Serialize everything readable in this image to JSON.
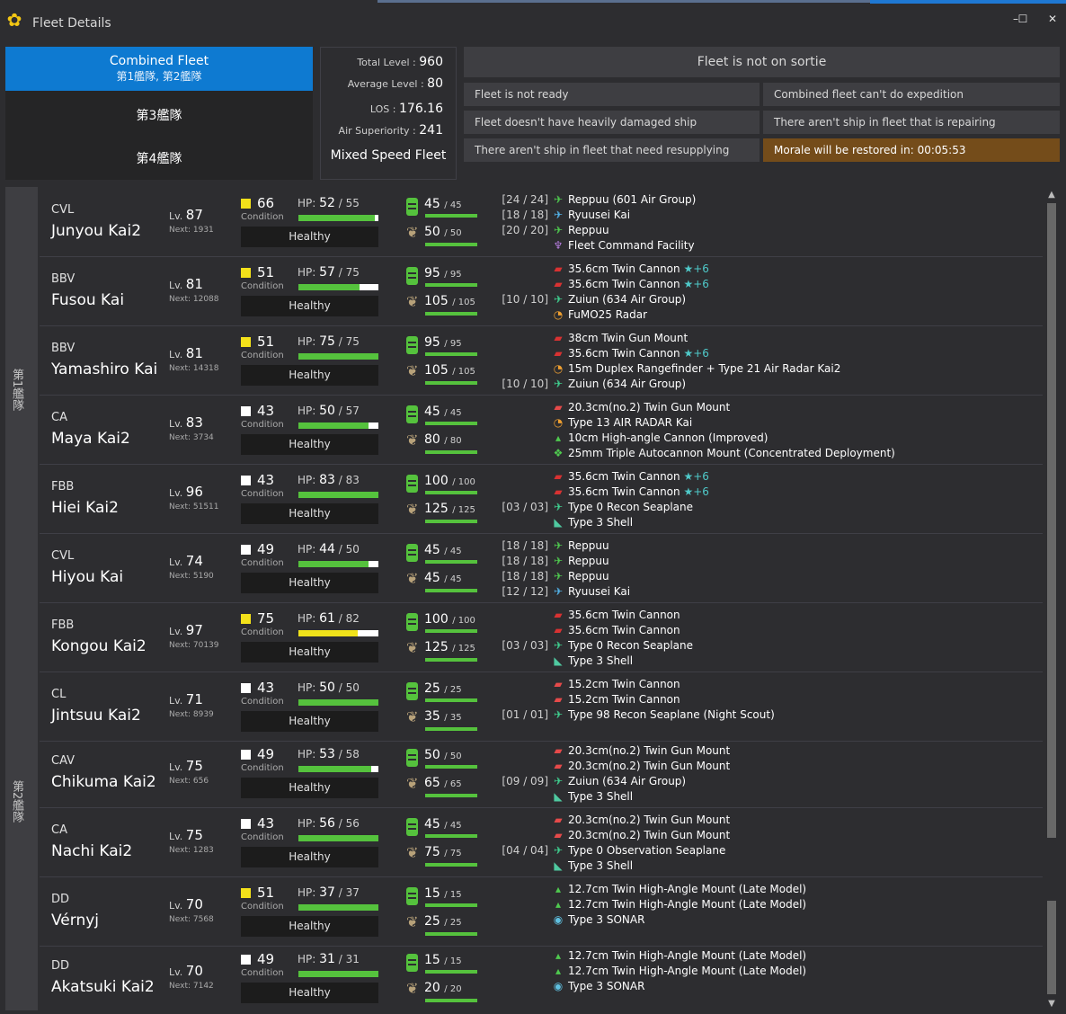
{
  "window": {
    "title": "Fleet Details",
    "min": "–",
    "max": "☐",
    "close": "✕"
  },
  "fleets": {
    "combined_title": "Combined Fleet",
    "combined_sub": "第1艦隊, 第2艦隊",
    "fleet3": "第3艦隊",
    "fleet4": "第4艦隊"
  },
  "stats": {
    "total_label": "Total Level :",
    "total": "960",
    "avg_label": "Average Level :",
    "avg": "80",
    "los_label": "LOS :",
    "los": "176.16",
    "air_label": "Air Superiority :",
    "air": "241",
    "speed": "Mixed Speed Fleet"
  },
  "status": {
    "sortie": "Fleet is not on sortie",
    "r1a": "Fleet is not ready",
    "r1b": "Combined fleet can't do expedition",
    "r2a": "Fleet doesn't have heavily damaged ship",
    "r2b": "There aren't ship in fleet that is repairing",
    "r3a": "There aren't ship in fleet that need resupplying",
    "r3b": "Morale will be restored in: 00:05:53"
  },
  "side": {
    "fleet1": "第1艦隊",
    "fleet2": "第2艦隊"
  },
  "labels": {
    "lv": "Lv.",
    "next": "Next:",
    "condition": "Condition",
    "hp": "HP:"
  },
  "colors": {
    "accent": "#0e7ad1",
    "bar_green": "#55c23d",
    "bar_yellow": "#f0e21a",
    "cond_yellow": "#f3e11a",
    "morale_bg": "#744c1a"
  },
  "ships": [
    {
      "type": "CVL",
      "name": "Junyou Kai2",
      "lv": "87",
      "next": "1931",
      "cond": "66",
      "cond_color": "yellow",
      "hp": "52",
      "maxhp": "55",
      "health": "Healthy",
      "fuel": "45",
      "maxfuel": "45",
      "ammo": "50",
      "maxammo": "50",
      "equip": [
        {
          "slot": "[24 / 24]",
          "icon": "fighter-icon",
          "name": "Reppuu (601 Air Group)"
        },
        {
          "slot": "[18 / 18]",
          "icon": "torpedo-bomber-icon",
          "name": "Ryuusei Kai"
        },
        {
          "slot": "[20 / 20]",
          "icon": "fighter-icon",
          "name": "Reppuu"
        },
        {
          "slot": "",
          "icon": "command-facility-icon",
          "name": "Fleet Command Facility"
        }
      ]
    },
    {
      "type": "BBV",
      "name": "Fusou Kai",
      "lv": "81",
      "next": "12088",
      "cond": "51",
      "cond_color": "yellow",
      "hp": "57",
      "maxhp": "75",
      "health": "Healthy",
      "fuel": "95",
      "maxfuel": "95",
      "ammo": "105",
      "maxammo": "105",
      "equip": [
        {
          "slot": "",
          "icon": "large-gun-icon",
          "name": "35.6cm Twin Cannon",
          "star": "★+6"
        },
        {
          "slot": "",
          "icon": "large-gun-icon",
          "name": "35.6cm Twin Cannon",
          "star": "★+6"
        },
        {
          "slot": "[10 / 10]",
          "icon": "seaplane-icon",
          "name": "Zuiun (634 Air Group)"
        },
        {
          "slot": "",
          "icon": "radar-icon",
          "name": "FuMO25 Radar"
        }
      ]
    },
    {
      "type": "BBV",
      "name": "Yamashiro Kai",
      "lv": "81",
      "next": "14318",
      "cond": "51",
      "cond_color": "yellow",
      "hp": "75",
      "maxhp": "75",
      "health": "Healthy",
      "fuel": "95",
      "maxfuel": "95",
      "ammo": "105",
      "maxammo": "105",
      "equip": [
        {
          "slot": "",
          "icon": "large-gun-icon",
          "name": "38cm Twin Gun Mount"
        },
        {
          "slot": "",
          "icon": "large-gun-icon",
          "name": "35.6cm Twin Cannon",
          "star": "★+6"
        },
        {
          "slot": "",
          "icon": "radar-icon",
          "name": "15m Duplex Rangefinder + Type 21 Air Radar Kai2"
        },
        {
          "slot": "[10 / 10]",
          "icon": "seaplane-icon",
          "name": "Zuiun (634 Air Group)"
        }
      ]
    },
    {
      "type": "CA",
      "name": "Maya Kai2",
      "lv": "83",
      "next": "3734",
      "cond": "43",
      "cond_color": "white",
      "hp": "50",
      "maxhp": "57",
      "health": "Healthy",
      "fuel": "45",
      "maxfuel": "45",
      "ammo": "80",
      "maxammo": "80",
      "equip": [
        {
          "slot": "",
          "icon": "medium-gun-icon",
          "name": "20.3cm(no.2) Twin Gun Mount"
        },
        {
          "slot": "",
          "icon": "radar-icon",
          "name": "Type 13 AIR RADAR Kai"
        },
        {
          "slot": "",
          "icon": "high-angle-gun-icon",
          "name": "10cm High-angle Cannon (Improved)"
        },
        {
          "slot": "",
          "icon": "aa-gun-icon",
          "name": "25mm Triple Autocannon Mount (Concentrated Deployment)"
        }
      ]
    },
    {
      "type": "FBB",
      "name": "Hiei Kai2",
      "lv": "96",
      "next": "51511",
      "cond": "43",
      "cond_color": "white",
      "hp": "83",
      "maxhp": "83",
      "health": "Healthy",
      "fuel": "100",
      "maxfuel": "100",
      "ammo": "125",
      "maxammo": "125",
      "equip": [
        {
          "slot": "",
          "icon": "large-gun-icon",
          "name": "35.6cm Twin Cannon",
          "star": "★+6"
        },
        {
          "slot": "",
          "icon": "large-gun-icon",
          "name": "35.6cm Twin Cannon",
          "star": "★+6"
        },
        {
          "slot": "[03 / 03]",
          "icon": "seaplane-icon",
          "name": "Type 0 Recon Seaplane"
        },
        {
          "slot": "",
          "icon": "shell-icon",
          "name": "Type 3 Shell"
        }
      ]
    },
    {
      "type": "CVL",
      "name": "Hiyou Kai",
      "lv": "74",
      "next": "5190",
      "cond": "49",
      "cond_color": "white",
      "hp": "44",
      "maxhp": "50",
      "health": "Healthy",
      "fuel": "45",
      "maxfuel": "45",
      "ammo": "45",
      "maxammo": "45",
      "equip": [
        {
          "slot": "[18 / 18]",
          "icon": "fighter-icon",
          "name": "Reppuu"
        },
        {
          "slot": "[18 / 18]",
          "icon": "fighter-icon",
          "name": "Reppuu"
        },
        {
          "slot": "[18 / 18]",
          "icon": "fighter-icon",
          "name": "Reppuu"
        },
        {
          "slot": "[12 / 12]",
          "icon": "torpedo-bomber-icon",
          "name": "Ryuusei Kai"
        }
      ]
    },
    {
      "type": "FBB",
      "name": "Kongou Kai2",
      "lv": "97",
      "next": "70139",
      "cond": "75",
      "cond_color": "yellow",
      "hp": "61",
      "maxhp": "82",
      "health": "Healthy",
      "hp_color": "yellow",
      "fuel": "100",
      "maxfuel": "100",
      "ammo": "125",
      "maxammo": "125",
      "equip": [
        {
          "slot": "",
          "icon": "large-gun-icon",
          "name": "35.6cm Twin Cannon"
        },
        {
          "slot": "",
          "icon": "large-gun-icon",
          "name": "35.6cm Twin Cannon"
        },
        {
          "slot": "[03 / 03]",
          "icon": "seaplane-icon",
          "name": "Type 0 Recon Seaplane"
        },
        {
          "slot": "",
          "icon": "shell-icon",
          "name": "Type 3 Shell"
        }
      ]
    },
    {
      "type": "CL",
      "name": "Jintsuu Kai2",
      "lv": "71",
      "next": "8939",
      "cond": "43",
      "cond_color": "white",
      "hp": "50",
      "maxhp": "50",
      "health": "Healthy",
      "fuel": "25",
      "maxfuel": "25",
      "ammo": "35",
      "maxammo": "35",
      "equip": [
        {
          "slot": "",
          "icon": "medium-gun-icon",
          "name": "15.2cm Twin Cannon"
        },
        {
          "slot": "",
          "icon": "medium-gun-icon",
          "name": "15.2cm Twin Cannon"
        },
        {
          "slot": "[01 / 01]",
          "icon": "seaplane-icon",
          "name": "Type 98 Recon Seaplane (Night Scout)"
        }
      ]
    },
    {
      "type": "CAV",
      "name": "Chikuma Kai2",
      "lv": "75",
      "next": "656",
      "cond": "49",
      "cond_color": "white",
      "hp": "53",
      "maxhp": "58",
      "health": "Healthy",
      "fuel": "50",
      "maxfuel": "50",
      "ammo": "65",
      "maxammo": "65",
      "equip": [
        {
          "slot": "",
          "icon": "medium-gun-icon",
          "name": "20.3cm(no.2) Twin Gun Mount"
        },
        {
          "slot": "",
          "icon": "medium-gun-icon",
          "name": "20.3cm(no.2) Twin Gun Mount"
        },
        {
          "slot": "[09 / 09]",
          "icon": "seaplane-icon",
          "name": "Zuiun (634 Air Group)"
        },
        {
          "slot": "",
          "icon": "shell-icon",
          "name": "Type 3 Shell"
        }
      ]
    },
    {
      "type": "CA",
      "name": "Nachi Kai2",
      "lv": "75",
      "next": "1283",
      "cond": "43",
      "cond_color": "white",
      "hp": "56",
      "maxhp": "56",
      "health": "Healthy",
      "fuel": "45",
      "maxfuel": "45",
      "ammo": "75",
      "maxammo": "75",
      "equip": [
        {
          "slot": "",
          "icon": "medium-gun-icon",
          "name": "20.3cm(no.2) Twin Gun Mount"
        },
        {
          "slot": "",
          "icon": "medium-gun-icon",
          "name": "20.3cm(no.2) Twin Gun Mount"
        },
        {
          "slot": "[04 / 04]",
          "icon": "seaplane-icon",
          "name": "Type 0 Observation Seaplane"
        },
        {
          "slot": "",
          "icon": "shell-icon",
          "name": "Type 3 Shell"
        }
      ]
    },
    {
      "type": "DD",
      "name": "Vérnyj",
      "lv": "70",
      "next": "7568",
      "cond": "51",
      "cond_color": "yellow",
      "hp": "37",
      "maxhp": "37",
      "health": "Healthy",
      "fuel": "15",
      "maxfuel": "15",
      "ammo": "25",
      "maxammo": "25",
      "equip": [
        {
          "slot": "",
          "icon": "high-angle-gun-icon",
          "name": "12.7cm Twin High-Angle Mount (Late Model)"
        },
        {
          "slot": "",
          "icon": "high-angle-gun-icon",
          "name": "12.7cm Twin High-Angle Mount (Late Model)"
        },
        {
          "slot": "",
          "icon": "sonar-icon",
          "name": "Type 3 SONAR"
        }
      ]
    },
    {
      "type": "DD",
      "name": "Akatsuki Kai2",
      "lv": "70",
      "next": "7142",
      "cond": "49",
      "cond_color": "white",
      "hp": "31",
      "maxhp": "31",
      "health": "Healthy",
      "fuel": "15",
      "maxfuel": "15",
      "ammo": "20",
      "maxammo": "20",
      "equip": [
        {
          "slot": "",
          "icon": "high-angle-gun-icon",
          "name": "12.7cm Twin High-Angle Mount (Late Model)"
        },
        {
          "slot": "",
          "icon": "high-angle-gun-icon",
          "name": "12.7cm Twin High-Angle Mount (Late Model)"
        },
        {
          "slot": "",
          "icon": "sonar-icon",
          "name": "Type 3 SONAR"
        }
      ]
    }
  ]
}
